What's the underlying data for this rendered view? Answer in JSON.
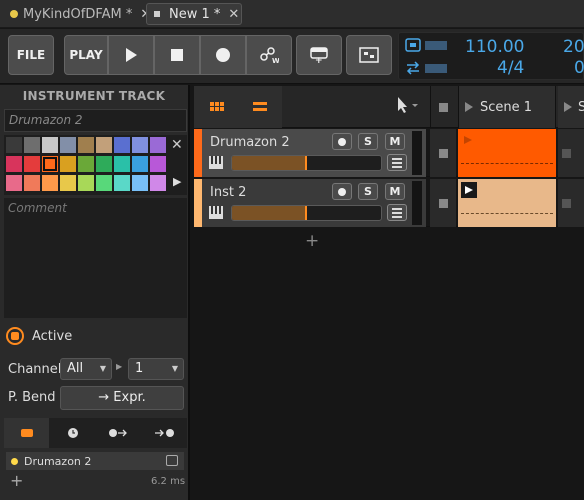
{
  "tabs": [
    {
      "label": "MyKindOfDFAM *",
      "dot_color": "#e8c84a"
    },
    {
      "label": "New 1 *",
      "active": true
    }
  ],
  "toolbar": {
    "file_label": "FILE",
    "play_label": "PLAY",
    "tempo": "110.00",
    "time_signature": "4/4",
    "position_top": "20",
    "position_bottom": "0"
  },
  "inspector": {
    "title": "INSTRUMENT TRACK",
    "track_name": "Drumazon 2",
    "comment_placeholder": "Comment",
    "active_label": "Active",
    "channel_label": "Channel",
    "channel_value": "All",
    "channel_number": "1",
    "pbend_label": "P. Bend",
    "pbend_button": "→ Expr.",
    "device_name": "Drumazon 2",
    "latency": "6.2 ms",
    "palette": [
      [
        "#3a3a3a",
        "#6e6e6e",
        "#c8c8c8",
        "#828fa8",
        "#a07f4e",
        "#c2a07a",
        "#5a6fd0",
        "#8090e0",
        "#9a6ad6"
      ],
      [
        "#d8345c",
        "#e43c3c",
        "#ff6a1a",
        "#d9a020",
        "#6aa838",
        "#2eab5a",
        "#2ac0a8",
        "#3aa0e0",
        "#b858d8"
      ],
      [
        "#e86a8a",
        "#f07a5a",
        "#ff9a4a",
        "#e8c84a",
        "#a8d858",
        "#58d87a",
        "#5ad8c8",
        "#78c0f8",
        "#d088e8"
      ]
    ],
    "selected_swatch": "#ff6a1a"
  },
  "scenes": {
    "scene1": "Scene 1",
    "scene2": "S"
  },
  "tracks": [
    {
      "name": "Drumazon 2",
      "color": "#ff6a1a",
      "volume_fraction": 0.5,
      "clip_color": "#ff5a00",
      "selected": true
    },
    {
      "name": "Inst 2",
      "color": "#ffb870",
      "volume_fraction": 0.5,
      "clip_color": "#e8b88a",
      "selected": false
    }
  ],
  "buttons": {
    "solo": "S",
    "mute": "M"
  }
}
